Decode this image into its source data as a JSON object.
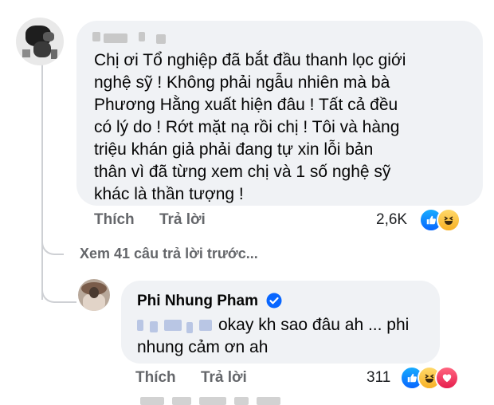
{
  "comment1": {
    "text": "Chị ơi Tổ nghiệp đã bắt đầu thanh lọc giới\nnghệ sỹ ! Không phải ngẫu nhiên mà bà\nPhương Hằng xuất hiện đâu ! Tất cả đều\ncó lý do ! Rớt mặt nạ rồi chị ! Tôi và hàng\ntriệu khán giả phải đang tự xin lỗi bản\nthân vì đã từng xem chị và 1 số nghệ sỹ\nkhác là thần tượng !",
    "like_label": "Thích",
    "reply_label": "Trả lời",
    "reaction_count": "2,6K",
    "reactions": [
      "like-icon",
      "haha-icon"
    ]
  },
  "view_more": "Xem 41 câu trả lời trước...",
  "reply": {
    "author": "Phi Nhung Pham",
    "text": "okay kh sao đâu ah ... phi nhung cảm ơn ah",
    "like_label": "Thích",
    "reply_label": "Trả lời",
    "reaction_count": "311",
    "reactions": [
      "like-icon",
      "haha-icon",
      "love-icon"
    ]
  },
  "colors": {
    "bubble": "#f0f2f5",
    "meta_text": "#65676b",
    "verified": "#0866ff",
    "like": "#0866ff",
    "haha": "#f7b125",
    "love": "#e61e4d"
  }
}
